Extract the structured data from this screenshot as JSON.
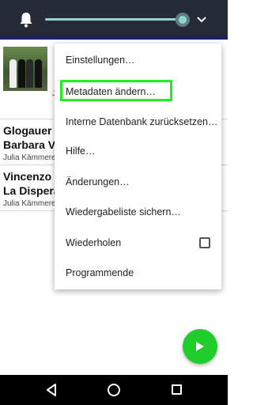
{
  "topbar": {
    "bell_icon": "bell-icon",
    "volume_slider_level": 0.95,
    "menu_icon": "chevron-down-icon",
    "colors": {
      "bar": "#252a36",
      "accent": "#8fd6cf"
    }
  },
  "list": {
    "items": [
      {
        "title_fragment": "",
        "artist": "J"
      },
      {
        "title_line1": "Glogauer l",
        "title_line2": "Barbara Vi",
        "artist": "Julia Kämmere"
      },
      {
        "title_line1": "Vincenzo I",
        "title_line2": "La Dispera",
        "artist": "Julia Kämmere"
      }
    ]
  },
  "menu": {
    "items": [
      {
        "label": "Einstellungen…"
      },
      {
        "label": "Metadaten ändern…"
      },
      {
        "label": "Interne Datenbank zurücksetzen…"
      },
      {
        "label": "Hilfe…"
      },
      {
        "label": "Änderungen…"
      },
      {
        "label": "Wiedergabeliste sichern…"
      },
      {
        "label": "Wiederholen",
        "checkbox_checked": false
      },
      {
        "label": "Programmende"
      }
    ],
    "highlight_color": "#22ee22"
  },
  "fab": {
    "icon": "play-icon",
    "color": "#1fce2a"
  },
  "navbar": {
    "back_icon": "back-icon",
    "home_icon": "home-icon",
    "recent_icon": "recent-apps-icon"
  }
}
